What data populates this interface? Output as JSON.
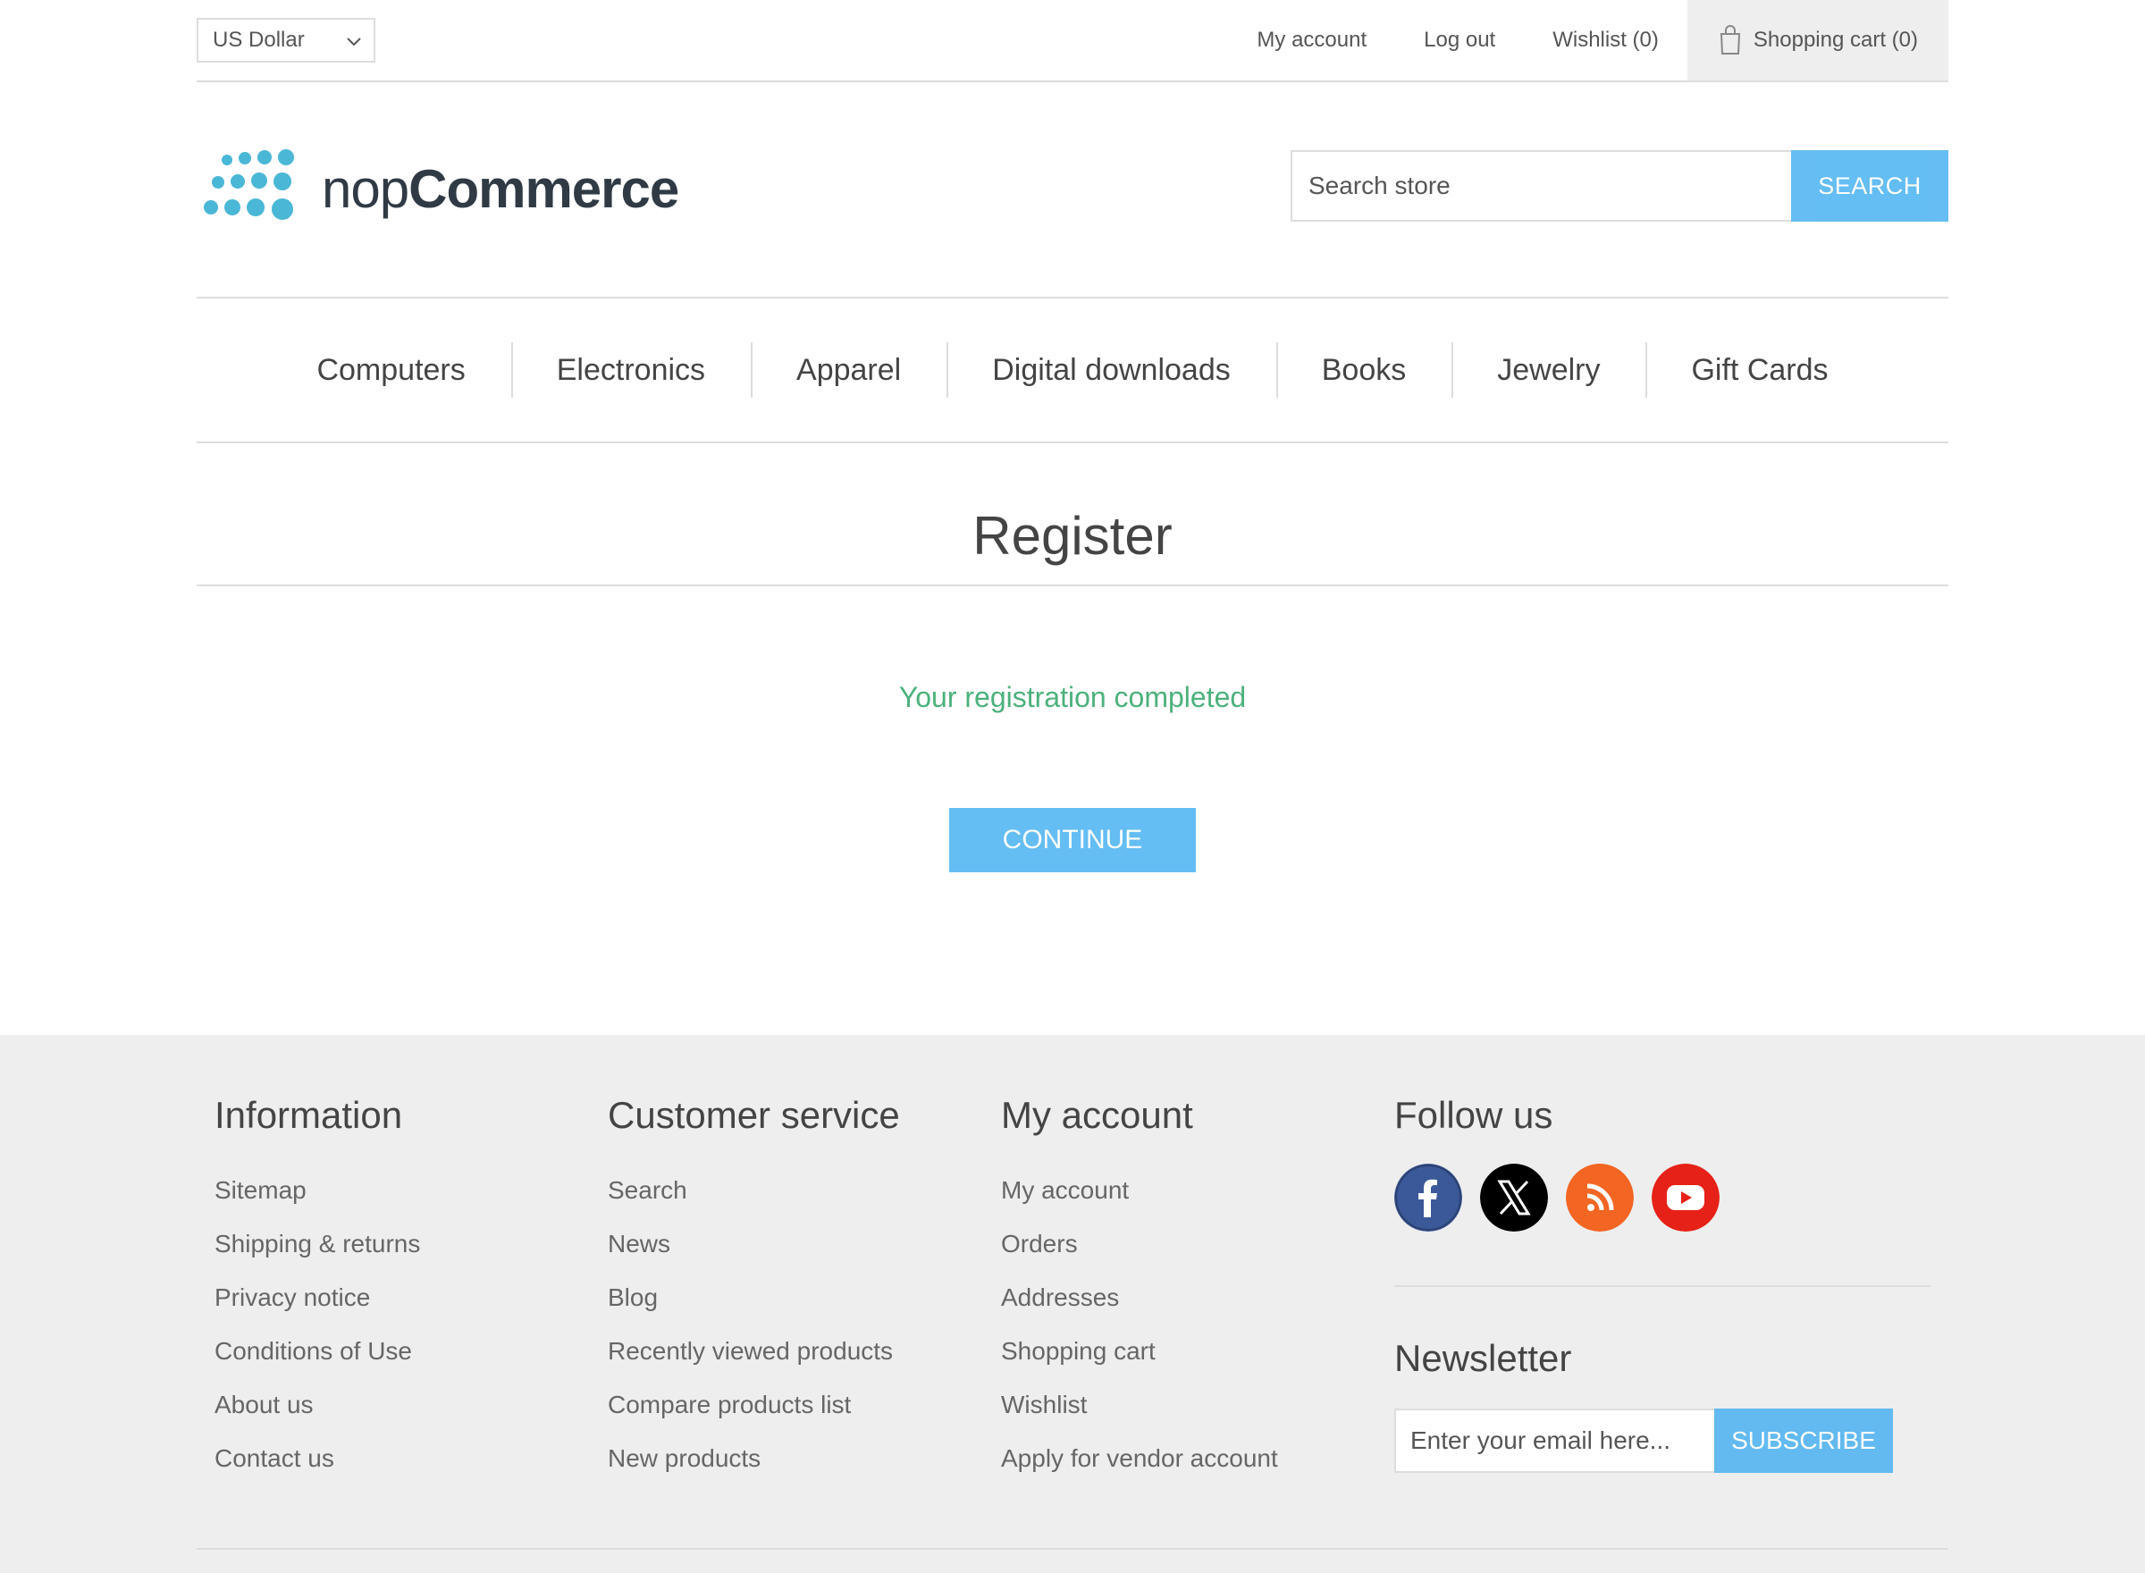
{
  "header": {
    "currency": "US Dollar",
    "links": {
      "my_account": "My account",
      "log_out": "Log out",
      "wishlist": "Wishlist (0)",
      "shopping_cart": "Shopping cart (0)"
    }
  },
  "logo": {
    "text_light": "nop",
    "text_bold": "Commerce"
  },
  "search": {
    "placeholder": "Search store",
    "button": "SEARCH"
  },
  "menu": [
    "Computers",
    "Electronics",
    "Apparel",
    "Digital downloads",
    "Books",
    "Jewelry",
    "Gift Cards"
  ],
  "page": {
    "title": "Register",
    "result": "Your registration completed",
    "continue": "CONTINUE"
  },
  "footer": {
    "information": {
      "title": "Information",
      "items": [
        "Sitemap",
        "Shipping & returns",
        "Privacy notice",
        "Conditions of Use",
        "About us",
        "Contact us"
      ]
    },
    "customer_service": {
      "title": "Customer service",
      "items": [
        "Search",
        "News",
        "Blog",
        "Recently viewed products",
        "Compare products list",
        "New products"
      ]
    },
    "my_account": {
      "title": "My account",
      "items": [
        "My account",
        "Orders",
        "Addresses",
        "Shopping cart",
        "Wishlist",
        "Apply for vendor account"
      ]
    },
    "follow_us": {
      "title": "Follow us",
      "icons": [
        "facebook-icon",
        "x-twitter-icon",
        "rss-icon",
        "youtube-icon"
      ]
    },
    "newsletter": {
      "title": "Newsletter",
      "placeholder": "Enter your email here...",
      "button": "SUBSCRIBE"
    }
  },
  "colors": {
    "accent": "#4ab2f1",
    "success": "#4cb17c",
    "footer_bg": "#eeeeee",
    "facebook": "#3b5998",
    "x": "#000000",
    "rss": "#f26522",
    "youtube": "#e62117"
  }
}
